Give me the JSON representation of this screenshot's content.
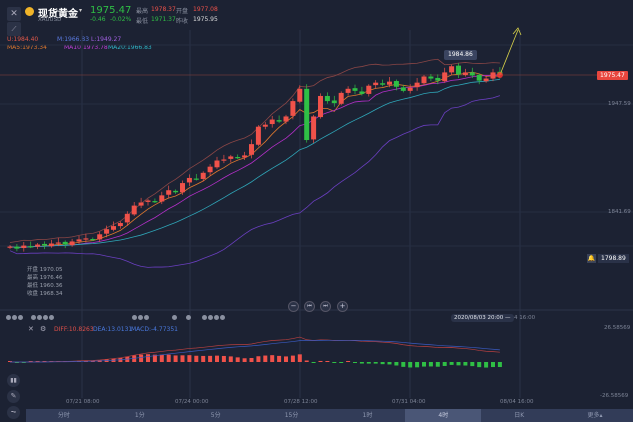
{
  "header": {
    "title": "现货黄金",
    "symbol": "XAUUSD",
    "price": "1975.47",
    "change": "-0.46",
    "change_pct": "-0.02%",
    "stats": [
      {
        "label": "最高",
        "value": "1978.37",
        "color": "red"
      },
      {
        "label": "开盘",
        "value": "1977.08",
        "color": "red"
      },
      {
        "label": "最低",
        "value": "1971.37",
        "color": "green"
      },
      {
        "label": "昨收",
        "value": "1975.95",
        "color": "white"
      }
    ]
  },
  "indicators": {
    "boll": {
      "u": "U:1984.40",
      "m": "M:1966.83",
      "l": "L:1949.27"
    },
    "ma": {
      "ma5": "MA5:1973.34",
      "ma10": "MA10:1973.78",
      "ma20": "MA20:1966.83"
    },
    "macd": {
      "diff": "DIFF:10.8263",
      "dea": "DEA:13.0131",
      "macd": "MACD:-4.77351"
    }
  },
  "price_axis": {
    "current": "1975.47",
    "p1": "1947.59",
    "p2": "1841.69",
    "alert": "1798.89",
    "macd_top": "26.58569",
    "macd_bottom": "-26.58569"
  },
  "tooltip": {
    "high_marker": "1984.86",
    "crosshair_time": "2020/08/03 20:00",
    "crosshair_time_tail": "4 16:00"
  },
  "ohlc_box": [
    {
      "label": "开盘",
      "value": "1970.05"
    },
    {
      "label": "最高",
      "value": "1976.46"
    },
    {
      "label": "最低",
      "value": "1960.36"
    },
    {
      "label": "收盘",
      "value": "1968.34"
    }
  ],
  "time_labels": [
    "07/21 08:00",
    "07/24 00:00",
    "07/28 12:00",
    "07/31 04:00",
    "08/04 16:00"
  ],
  "zoom_controls": [
    "−",
    "⏮",
    "⏭",
    "+"
  ],
  "tabs": [
    "分时",
    "1分",
    "5分",
    "15分",
    "1时",
    "4时",
    "日K",
    "更多▴"
  ],
  "active_tab": "4时",
  "colors": {
    "up": "#f0524a",
    "down": "#2fbf45",
    "ma5": "#e0782e",
    "ma10": "#b32fc8",
    "ma20": "#2fa6b8",
    "boll_upper": "#8a4646",
    "boll_lower": "#6a3fc0",
    "bg": "#1c2233"
  },
  "chart_data": {
    "type": "candlestick",
    "price_range": [
      1798.89,
      1990
    ],
    "closes": [
      1808,
      1806,
      1809,
      1808,
      1810,
      1809,
      1811,
      1812,
      1810,
      1813,
      1815,
      1816,
      1815,
      1820,
      1825,
      1828,
      1831,
      1840,
      1848,
      1851,
      1853,
      1852,
      1858,
      1863,
      1861,
      1870,
      1875,
      1874,
      1880,
      1886,
      1892,
      1893,
      1896,
      1895,
      1897,
      1908,
      1925,
      1927,
      1932,
      1930,
      1935,
      1950,
      1962,
      1912,
      1935,
      1955,
      1950,
      1948,
      1958,
      1962,
      1960,
      1957,
      1965,
      1968,
      1966,
      1969,
      1964,
      1960,
      1963,
      1968,
      1974,
      1972,
      1970,
      1978,
      1984,
      1976,
      1978,
      1975,
      1970,
      1972,
      1978,
      1975.47
    ]
  }
}
